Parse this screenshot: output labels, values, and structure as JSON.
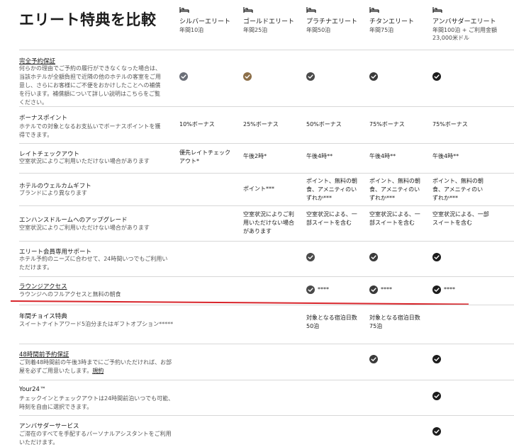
{
  "page_title": "エリート特典を比較",
  "colors": {
    "silver": "#6b6f78",
    "gold": "#8c6f49",
    "dark": "#2f2f2f",
    "highlight": "#d8252b"
  },
  "tiers": [
    {
      "icon": "bed-icon",
      "name": "シルバーエリート",
      "req": "年間10泊"
    },
    {
      "icon": "bed-icon",
      "name": "ゴールドエリート",
      "req": "年間25泊"
    },
    {
      "icon": "bed-icon",
      "name": "プラチナエリート",
      "req": "年間50泊"
    },
    {
      "icon": "bed-icon",
      "name": "チタンエリート",
      "req": "年間75泊"
    },
    {
      "icon": "bed-icon",
      "name": "アンバサダーエリート",
      "req": "年間100泊 + ご利用金額23,000米ドル"
    }
  ],
  "rows": [
    {
      "title": "完全予約保証",
      "desc": "何らかの理由でご予約の履行ができなくなった場合は、当該ホテルが全額負担で近隣の他のホテルの客室をご用意し、さらにお客様にご不便をおかけしたことへの補償を行います。補償額について詳しい説明はこちらをご覧ください。",
      "cells": [
        "check",
        "check",
        "check",
        "check",
        "check"
      ]
    },
    {
      "title": "ボーナスポイント",
      "desc": "ホテルでの対象となるお支払いでボーナスポイントを獲得できます。",
      "cells": [
        "10%ボーナス",
        "25%ボーナス",
        "50%ボーナス",
        "75%ボーナス",
        "75%ボーナス"
      ]
    },
    {
      "title": "レイトチェックアウト",
      "desc": "空室状況によりご利用いただけない場合があります",
      "cells": [
        "優先レイトチェックアウト*",
        "午後2時*",
        "午後4時**",
        "午後4時**",
        "午後4時**"
      ]
    },
    {
      "title": "ホテルのウェルカムギフト",
      "desc": "ブランドにより異なります",
      "cells": [
        "",
        "ポイント***",
        "ポイント、無料の朝食、アメニティのいずれか***",
        "ポイント、無料の朝食、アメニティのいずれか***",
        "ポイント、無料の朝食、アメニティのいずれか***"
      ]
    },
    {
      "title": "エンハンスドルームへのアップグレード",
      "desc": "空室状況によりご利用いただけない場合があります",
      "cells": [
        "",
        "空室状況によりご利用いただけない場合があります",
        "空室状況による、一部スイートを含む",
        "空室状況による、一部スイートを含む",
        "空室状況による、一部スイートを含む"
      ]
    },
    {
      "title": "エリート会員専用サポート",
      "desc": "ホテル予約のニーズに合わせて、24時間いつでもご利用いただけます。",
      "cells": [
        "",
        "",
        "check",
        "check",
        "check"
      ]
    },
    {
      "title": "ラウンジアクセス",
      "desc": "ラウンジへのフルアクセスと無料の朝食",
      "stars": "****",
      "cells": [
        "",
        "",
        "check",
        "check",
        "check"
      ]
    },
    {
      "title": "年間チョイス特典",
      "desc": "スイートナイトアワード5泊分またはギフトオプション*****",
      "cells": [
        "",
        "",
        "対象となる宿泊日数50泊",
        "対象となる宿泊日数75泊",
        ""
      ]
    },
    {
      "title": "48時間前予約保証",
      "desc": "ご到着48時間前の午後3時までにご予約いただければ、お部屋を必ずご用意いたします。",
      "desc_link": "規約",
      "cells": [
        "",
        "",
        "",
        "check",
        "check"
      ]
    },
    {
      "title": "Your24™",
      "desc": "チェックインとチェックアウトは24時間前泊いつでも可能、時刻を自由に選択できます。",
      "cells": [
        "",
        "",
        "",
        "",
        "check"
      ]
    },
    {
      "title": "アンバサダーサービス",
      "desc": "ご滞在のすべてを手配するパーソナルアシスタントをご利用いただけます。",
      "cells": [
        "",
        "",
        "",
        "",
        "check"
      ]
    }
  ]
}
